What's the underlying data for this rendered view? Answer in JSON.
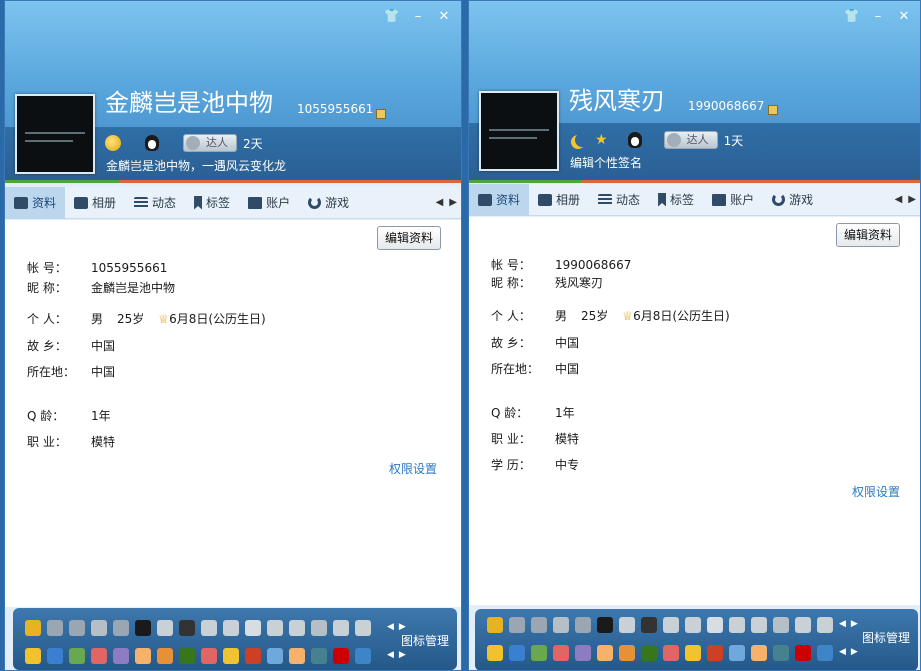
{
  "windows": [
    {
      "id": "left",
      "nickname": "金麟岂是池中物",
      "qq_number": "1055955661",
      "talent_badge": "达人",
      "active_days": "2天",
      "signature": "金麟岂是池中物，一遇风云变化龙",
      "edit_button": "编辑资料",
      "permission_link": "权限设置",
      "fields": [
        {
          "label": "帐 号：",
          "value": "1055955661"
        },
        {
          "label": "昵 称：",
          "value": "金麟岂是池中物"
        },
        {
          "label": "个 人：",
          "gender": "男",
          "age": "25岁",
          "birthday": "6月8日(公历生日)"
        },
        {
          "label": "故 乡：",
          "value": "中国"
        },
        {
          "label": "所在地：",
          "value": "中国"
        },
        {
          "label": "Q 龄：",
          "value": "1年"
        },
        {
          "label": "职 业：",
          "value": "模特"
        }
      ]
    },
    {
      "id": "right",
      "nickname": "残风寒刃",
      "qq_number": "1990068667",
      "talent_badge": "达人",
      "active_days": "1天",
      "signature": "编辑个性签名",
      "edit_button": "编辑资料",
      "permission_link": "权限设置",
      "fields": [
        {
          "label": "帐 号：",
          "value": "1990068667"
        },
        {
          "label": "昵 称：",
          "value": "残风寒刃"
        },
        {
          "label": "个 人：",
          "gender": "男",
          "age": "25岁",
          "birthday": "6月8日(公历生日)"
        },
        {
          "label": "故 乡：",
          "value": "中国"
        },
        {
          "label": "所在地：",
          "value": "中国"
        },
        {
          "label": "Q 龄：",
          "value": "1年"
        },
        {
          "label": "职 业：",
          "value": "模特"
        },
        {
          "label": "学 历：",
          "value": "中专"
        }
      ]
    }
  ],
  "tabs": [
    {
      "label": "资料",
      "icon": "profile-card-icon"
    },
    {
      "label": "相册",
      "icon": "album-icon"
    },
    {
      "label": "动态",
      "icon": "feed-list-icon"
    },
    {
      "label": "标签",
      "icon": "bookmark-icon"
    },
    {
      "label": "账户",
      "icon": "briefcase-icon"
    },
    {
      "label": "游戏",
      "icon": "game-icon"
    }
  ],
  "footer": {
    "manage_label": "图标管理"
  },
  "colors": {
    "header_top": "#7cc3ef",
    "header_band": "#2f6ea6",
    "accent_green": "#4aa83a",
    "accent_orange": "#d8683a",
    "link_blue": "#2a78c4",
    "footer_bg": "#245889"
  }
}
